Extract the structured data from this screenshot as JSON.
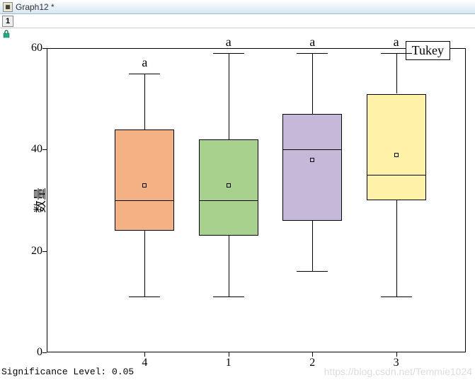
{
  "window": {
    "title": "Graph12 *"
  },
  "tab": {
    "label": "1"
  },
  "chart_data": {
    "type": "boxplot",
    "ylabel": "数量",
    "xlabel": "",
    "ylim": [
      0,
      60
    ],
    "yticks": [
      0,
      20,
      40,
      60
    ],
    "categories": [
      "4",
      "1",
      "2",
      "3"
    ],
    "series": [
      {
        "category": "4",
        "min": 11,
        "q1": 24,
        "median": 30,
        "q3": 44,
        "max": 55,
        "mean": 33,
        "sig_label": "a",
        "color": "#f4b183"
      },
      {
        "category": "1",
        "min": 11,
        "q1": 23,
        "median": 30,
        "q3": 42,
        "max": 59,
        "mean": 33,
        "sig_label": "a",
        "color": "#a9d18e"
      },
      {
        "category": "2",
        "min": 16,
        "q1": 26,
        "median": 40,
        "q3": 47,
        "max": 59,
        "mean": 38,
        "sig_label": "a",
        "color": "#c5b8d9"
      },
      {
        "category": "3",
        "min": 11,
        "q1": 30,
        "median": 35,
        "q3": 51,
        "max": 59,
        "mean": 39,
        "sig_label": "a",
        "color": "#fff2a8"
      }
    ],
    "legend": {
      "label": "Tukey"
    }
  },
  "footer": {
    "sig_level": "Significance Level: 0.05"
  },
  "watermark": "https://blog.csdn.net/Temmie1024"
}
